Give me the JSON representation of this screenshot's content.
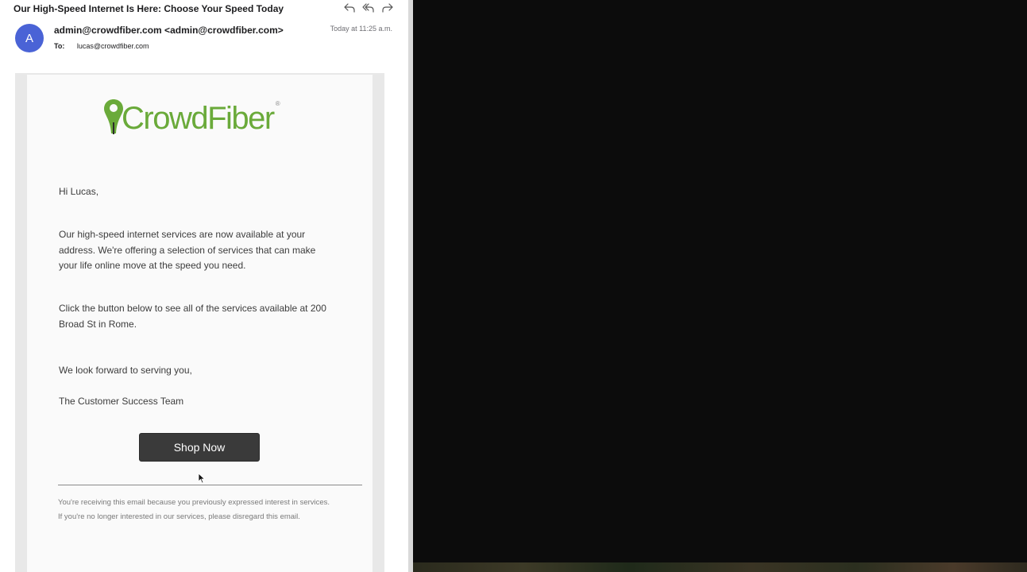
{
  "email": {
    "subject": "Our High-Speed Internet Is Here: Choose Your Speed Today",
    "avatar_initial": "A",
    "from": "admin@crowdfiber.com <admin@crowdfiber.com>",
    "date": "Today at 11:25 a.m.",
    "to_label": "To:",
    "to": "lucas@crowdfiber.com",
    "actions": [
      "reply-icon",
      "reply-all-icon",
      "forward-icon"
    ]
  },
  "content": {
    "logo_text": "CrowdFiber",
    "logo_reg": "®",
    "greeting": "Hi Lucas,",
    "paragraph1": "Our high-speed internet services are now available at your address. We're offering a selection of services that can make your life online move at the speed you need.",
    "paragraph2": "Click the button below to see all of the services available at 200 Broad St in Rome.",
    "closing": "We look forward to serving you,",
    "signature": "The Customer Success Team",
    "button_label": "Shop Now",
    "footer": "You're receiving this email because you previously expressed interest in services. If you're no longer interested in our services, please disregard this email."
  },
  "colors": {
    "avatar": "#4a63d6",
    "brand_green": "#6aaa3a",
    "button": "#3a3a3a"
  }
}
